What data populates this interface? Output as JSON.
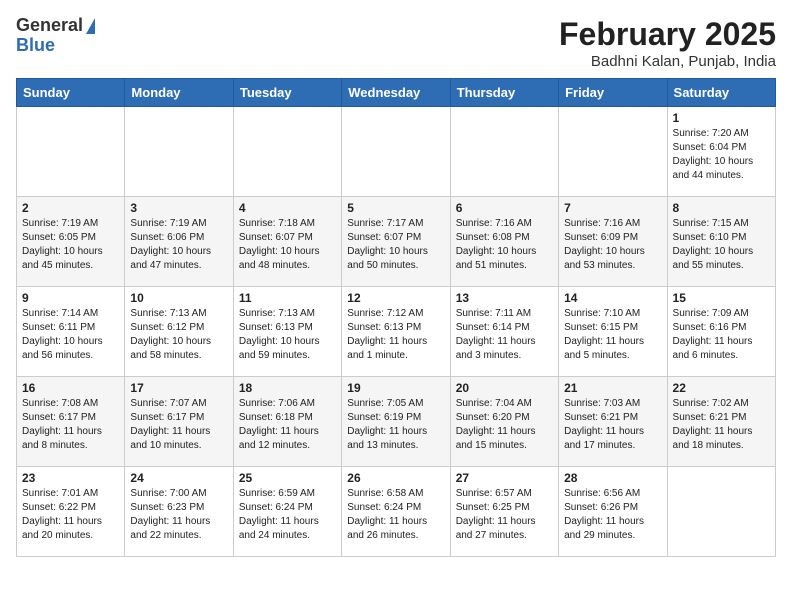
{
  "header": {
    "logo_general": "General",
    "logo_blue": "Blue",
    "title": "February 2025",
    "subtitle": "Badhni Kalan, Punjab, India"
  },
  "days_of_week": [
    "Sunday",
    "Monday",
    "Tuesday",
    "Wednesday",
    "Thursday",
    "Friday",
    "Saturday"
  ],
  "weeks": [
    [
      {
        "day": "",
        "info": ""
      },
      {
        "day": "",
        "info": ""
      },
      {
        "day": "",
        "info": ""
      },
      {
        "day": "",
        "info": ""
      },
      {
        "day": "",
        "info": ""
      },
      {
        "day": "",
        "info": ""
      },
      {
        "day": "1",
        "info": "Sunrise: 7:20 AM\nSunset: 6:04 PM\nDaylight: 10 hours\nand 44 minutes."
      }
    ],
    [
      {
        "day": "2",
        "info": "Sunrise: 7:19 AM\nSunset: 6:05 PM\nDaylight: 10 hours\nand 45 minutes."
      },
      {
        "day": "3",
        "info": "Sunrise: 7:19 AM\nSunset: 6:06 PM\nDaylight: 10 hours\nand 47 minutes."
      },
      {
        "day": "4",
        "info": "Sunrise: 7:18 AM\nSunset: 6:07 PM\nDaylight: 10 hours\nand 48 minutes."
      },
      {
        "day": "5",
        "info": "Sunrise: 7:17 AM\nSunset: 6:07 PM\nDaylight: 10 hours\nand 50 minutes."
      },
      {
        "day": "6",
        "info": "Sunrise: 7:16 AM\nSunset: 6:08 PM\nDaylight: 10 hours\nand 51 minutes."
      },
      {
        "day": "7",
        "info": "Sunrise: 7:16 AM\nSunset: 6:09 PM\nDaylight: 10 hours\nand 53 minutes."
      },
      {
        "day": "8",
        "info": "Sunrise: 7:15 AM\nSunset: 6:10 PM\nDaylight: 10 hours\nand 55 minutes."
      }
    ],
    [
      {
        "day": "9",
        "info": "Sunrise: 7:14 AM\nSunset: 6:11 PM\nDaylight: 10 hours\nand 56 minutes."
      },
      {
        "day": "10",
        "info": "Sunrise: 7:13 AM\nSunset: 6:12 PM\nDaylight: 10 hours\nand 58 minutes."
      },
      {
        "day": "11",
        "info": "Sunrise: 7:13 AM\nSunset: 6:13 PM\nDaylight: 10 hours\nand 59 minutes."
      },
      {
        "day": "12",
        "info": "Sunrise: 7:12 AM\nSunset: 6:13 PM\nDaylight: 11 hours\nand 1 minute."
      },
      {
        "day": "13",
        "info": "Sunrise: 7:11 AM\nSunset: 6:14 PM\nDaylight: 11 hours\nand 3 minutes."
      },
      {
        "day": "14",
        "info": "Sunrise: 7:10 AM\nSunset: 6:15 PM\nDaylight: 11 hours\nand 5 minutes."
      },
      {
        "day": "15",
        "info": "Sunrise: 7:09 AM\nSunset: 6:16 PM\nDaylight: 11 hours\nand 6 minutes."
      }
    ],
    [
      {
        "day": "16",
        "info": "Sunrise: 7:08 AM\nSunset: 6:17 PM\nDaylight: 11 hours\nand 8 minutes."
      },
      {
        "day": "17",
        "info": "Sunrise: 7:07 AM\nSunset: 6:17 PM\nDaylight: 11 hours\nand 10 minutes."
      },
      {
        "day": "18",
        "info": "Sunrise: 7:06 AM\nSunset: 6:18 PM\nDaylight: 11 hours\nand 12 minutes."
      },
      {
        "day": "19",
        "info": "Sunrise: 7:05 AM\nSunset: 6:19 PM\nDaylight: 11 hours\nand 13 minutes."
      },
      {
        "day": "20",
        "info": "Sunrise: 7:04 AM\nSunset: 6:20 PM\nDaylight: 11 hours\nand 15 minutes."
      },
      {
        "day": "21",
        "info": "Sunrise: 7:03 AM\nSunset: 6:21 PM\nDaylight: 11 hours\nand 17 minutes."
      },
      {
        "day": "22",
        "info": "Sunrise: 7:02 AM\nSunset: 6:21 PM\nDaylight: 11 hours\nand 18 minutes."
      }
    ],
    [
      {
        "day": "23",
        "info": "Sunrise: 7:01 AM\nSunset: 6:22 PM\nDaylight: 11 hours\nand 20 minutes."
      },
      {
        "day": "24",
        "info": "Sunrise: 7:00 AM\nSunset: 6:23 PM\nDaylight: 11 hours\nand 22 minutes."
      },
      {
        "day": "25",
        "info": "Sunrise: 6:59 AM\nSunset: 6:24 PM\nDaylight: 11 hours\nand 24 minutes."
      },
      {
        "day": "26",
        "info": "Sunrise: 6:58 AM\nSunset: 6:24 PM\nDaylight: 11 hours\nand 26 minutes."
      },
      {
        "day": "27",
        "info": "Sunrise: 6:57 AM\nSunset: 6:25 PM\nDaylight: 11 hours\nand 27 minutes."
      },
      {
        "day": "28",
        "info": "Sunrise: 6:56 AM\nSunset: 6:26 PM\nDaylight: 11 hours\nand 29 minutes."
      },
      {
        "day": "",
        "info": ""
      }
    ]
  ]
}
